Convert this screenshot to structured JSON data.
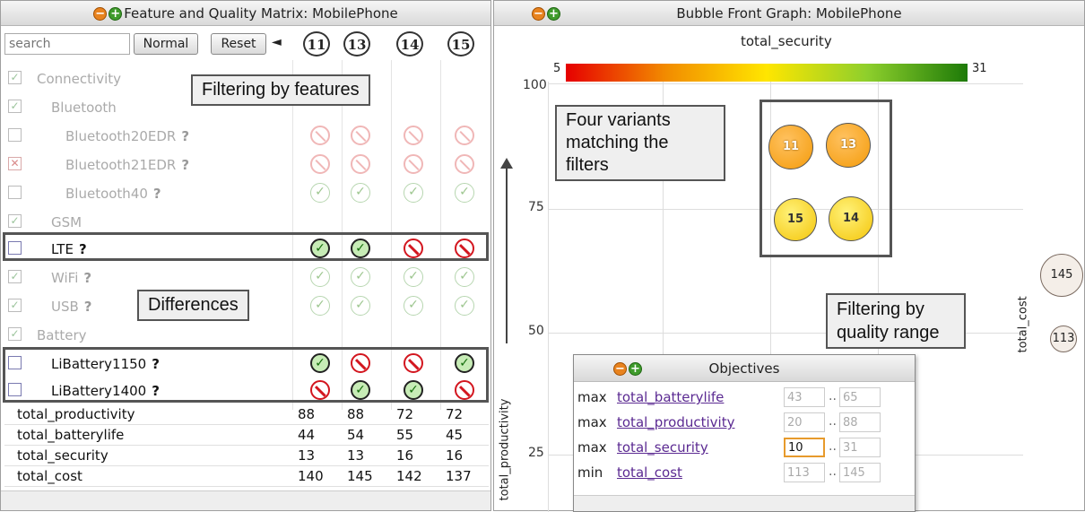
{
  "left_panel": {
    "title": "Feature and Quality Matrix: MobilePhone",
    "search_placeholder": "search",
    "normal_button": "Normal",
    "reset_button": "Reset",
    "collapse_arrow": "◄",
    "variants": [
      "11",
      "13",
      "14",
      "15"
    ],
    "features": [
      {
        "label": "Connectivity",
        "check": "✓"
      },
      {
        "label": "Bluetooth",
        "check": "✓"
      },
      {
        "label": "Bluetooth20EDR",
        "q": "?",
        "check": ""
      },
      {
        "label": "Bluetooth21EDR",
        "q": "?",
        "check": "✕"
      },
      {
        "label": "Bluetooth40",
        "q": "?",
        "check": ""
      },
      {
        "label": "GSM",
        "check": "✓"
      },
      {
        "label": "LTE",
        "q": "?",
        "check": ""
      },
      {
        "label": "WiFi",
        "q": "?",
        "check": "✓"
      },
      {
        "label": "USB",
        "q": "?",
        "check": "✓"
      },
      {
        "label": "Battery",
        "check": "✓"
      },
      {
        "label": "LiBattery1150",
        "q": "?",
        "check": ""
      },
      {
        "label": "LiBattery1400",
        "q": "?",
        "check": ""
      }
    ],
    "check_glyph": "✓",
    "quality_rows": [
      {
        "name": "total_productivity",
        "values": [
          "88",
          "88",
          "72",
          "72"
        ]
      },
      {
        "name": "total_batterylife",
        "values": [
          "44",
          "54",
          "55",
          "45"
        ]
      },
      {
        "name": "total_security",
        "values": [
          "13",
          "13",
          "16",
          "16"
        ]
      },
      {
        "name": "total_cost",
        "values": [
          "140",
          "145",
          "142",
          "137"
        ]
      }
    ],
    "callouts": {
      "filtering_features": "Filtering by features",
      "differences": "Differences"
    }
  },
  "right_panel": {
    "title": "Bubble Front Graph: MobilePhone",
    "color_metric": "total_security",
    "scale_min": "5",
    "scale_max": "31",
    "y_ticks": [
      "100",
      "75",
      "50",
      "25"
    ],
    "y_axis_label": "total_productivity",
    "cost_axis_label": "total_cost",
    "bubbles": [
      "11",
      "13",
      "15",
      "14"
    ],
    "cost_legend": [
      "145",
      "113"
    ],
    "callouts": {
      "four_variants": "Four variants matching the filters",
      "quality_range": "Filtering by quality range"
    },
    "objectives": {
      "title": "Objectives",
      "rows": [
        {
          "kind": "max",
          "name": "total_batterylife",
          "low": "43",
          "high": "65"
        },
        {
          "kind": "max",
          "name": "total_productivity",
          "low": "20",
          "high": "88"
        },
        {
          "kind": "max",
          "name": "total_security",
          "low": "10",
          "high": "31"
        },
        {
          "kind": "min",
          "name": "total_cost",
          "low": "113",
          "high": "145"
        }
      ],
      "range_sep": ".."
    }
  },
  "colors": {
    "bubble_orange": "#f49b0a",
    "bubble_yellow": "#f4c50a",
    "selected_green": "#146d0b",
    "excluded_red": "#d3161f"
  }
}
